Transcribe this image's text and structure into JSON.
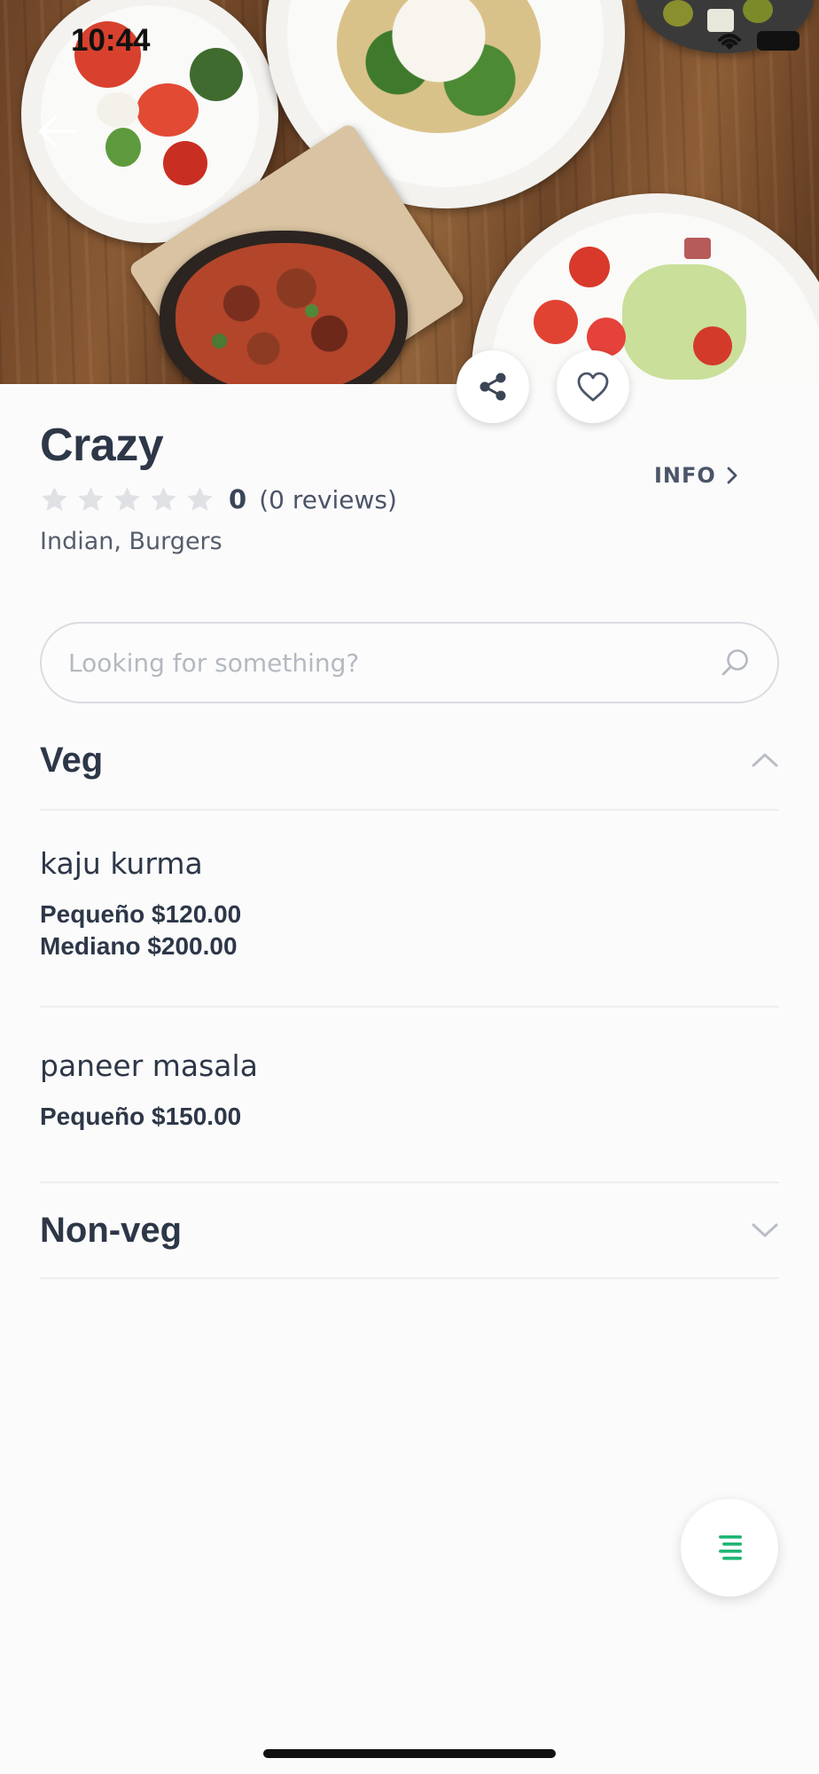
{
  "status_bar": {
    "time": "10:44"
  },
  "restaurant": {
    "name": "Crazy",
    "rating": {
      "stars": 0,
      "max": 5,
      "value": "0",
      "reviews": "(0 reviews)"
    },
    "cuisines": "Indian, Burgers",
    "info_label": "INFO"
  },
  "search": {
    "placeholder": "Looking for something?",
    "value": ""
  },
  "menu": {
    "sections": [
      {
        "title": "Veg",
        "expanded": true,
        "items": [
          {
            "name": "kaju kurma",
            "prices": [
              "Pequeño $120.00",
              "Mediano $200.00"
            ]
          },
          {
            "name": "paneer masala",
            "prices": [
              "Pequeño $150.00"
            ]
          }
        ]
      },
      {
        "title": "Non-veg",
        "expanded": false,
        "items": []
      }
    ]
  },
  "icons": {
    "back": "arrow-left-icon",
    "share": "share-icon",
    "favorite": "heart-icon",
    "info": "chevron-right-icon",
    "search": "search-icon",
    "collapse": "chevron-up-icon",
    "expand": "chevron-down-icon",
    "menu_fab": "menu-list-icon"
  },
  "colors": {
    "accent": "#21b573",
    "text": "#2d3748",
    "star_empty": "#dfe1e5",
    "divider": "#eceef1"
  }
}
